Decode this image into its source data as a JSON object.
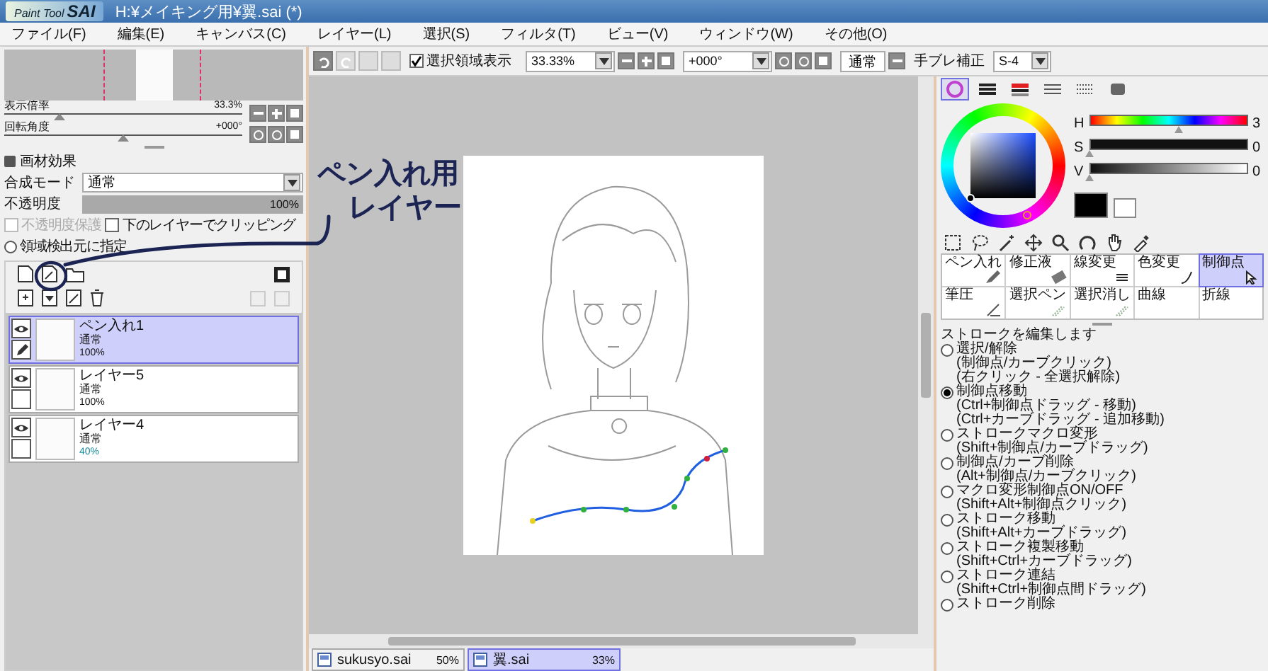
{
  "window": {
    "logo_top": "Paint Tool",
    "logo_main": "SAI",
    "title": "H:¥メイキング用¥翼.sai (*)"
  },
  "menu": [
    "ファイル(F)",
    "編集(E)",
    "キャンバス(C)",
    "レイヤー(L)",
    "選択(S)",
    "フィルタ(T)",
    "ビュー(V)",
    "ウィンドウ(W)",
    "その他(O)"
  ],
  "navigator": {
    "zoom": {
      "label": "表示倍率",
      "value": "33.3%",
      "level": 0.23
    },
    "rotation": {
      "label": "回転角度",
      "value": "+000°",
      "level": 0.5
    }
  },
  "layer_settings": {
    "texture_effect": "画材効果",
    "blend": {
      "label": "合成モード",
      "value": "通常"
    },
    "opacity": {
      "label": "不透明度",
      "value": "100%",
      "level": 1
    },
    "options": [
      {
        "label": "不透明度保護",
        "checked": false,
        "disabled": true
      },
      {
        "label": "下のレイヤーでクリッピング",
        "checked": false,
        "disabled": false
      }
    ],
    "source_radio": {
      "label": "領域検出元に指定",
      "selected": false
    }
  },
  "layers": [
    {
      "name": "ペン入れ1",
      "mode": "通常",
      "opacity": "100%",
      "selected": true,
      "visible": true,
      "pen": true,
      "dimmed": false
    },
    {
      "name": "レイヤー5",
      "mode": "通常",
      "opacity": "100%",
      "selected": false,
      "visible": true,
      "pen": false,
      "dimmed": false
    },
    {
      "name": "レイヤー4",
      "mode": "通常",
      "opacity": "40%",
      "selected": false,
      "visible": true,
      "pen": false,
      "dimmed": true
    }
  ],
  "toolbar": {
    "show_selection": {
      "label": "選択領域表示",
      "checked": true
    },
    "zoom": "33.33%",
    "angle": "+000°",
    "mode": "通常",
    "stabilizer_label": "手ブレ補正",
    "stabilizer": "S-4"
  },
  "color_tabs": [
    {
      "kind": "wheel",
      "selected": true
    },
    {
      "kind": "rgb",
      "selected": false
    },
    {
      "kind": "hsv",
      "selected": false
    },
    {
      "kind": "list",
      "selected": false
    },
    {
      "kind": "swatches",
      "selected": false
    },
    {
      "kind": "scratch",
      "selected": false
    }
  ],
  "hsv": [
    {
      "label": "H",
      "value": "3",
      "level": 0.56,
      "kind": "hue"
    },
    {
      "label": "S",
      "value": "0",
      "level": 0,
      "kind": "sat"
    },
    {
      "label": "V",
      "value": "0",
      "level": 0,
      "kind": "val"
    }
  ],
  "brushes": [
    {
      "name": "ペン入れ",
      "selected": false,
      "kind": "pen"
    },
    {
      "name": "修正液",
      "selected": false,
      "kind": "eraser"
    },
    {
      "name": "線変更",
      "selected": false,
      "kind": "lines"
    },
    {
      "name": "色変更",
      "selected": false,
      "kind": "color"
    },
    {
      "name": "制御点",
      "selected": true,
      "kind": "cursor"
    },
    {
      "name": "筆圧",
      "selected": false,
      "kind": "pressure"
    },
    {
      "name": "選択ペン",
      "selected": false,
      "kind": "select"
    },
    {
      "name": "選択消し",
      "selected": false,
      "kind": "select"
    },
    {
      "name": "曲線",
      "selected": false,
      "kind": "none"
    },
    {
      "name": "折線",
      "selected": false,
      "kind": "none"
    }
  ],
  "stroke_edit": {
    "heading": "ストロークを編集します",
    "modes": [
      {
        "label": "選択/解除",
        "selected": false,
        "hints": [
          "(制御点/カーブクリック)",
          "(右クリック - 全選択解除)"
        ]
      },
      {
        "label": "制御点移動",
        "selected": true,
        "hints": [
          "(Ctrl+制御点ドラッグ - 移動)",
          "(Ctrl+カーブドラッグ - 追加移動)"
        ]
      },
      {
        "label": "ストロークマクロ変形",
        "selected": false,
        "hints": [
          "(Shift+制御点/カーブドラッグ)"
        ]
      },
      {
        "label": "制御点/カーブ削除",
        "selected": false,
        "hints": [
          "(Alt+制御点/カーブクリック)"
        ]
      },
      {
        "label": "マクロ変形制御点ON/OFF",
        "selected": false,
        "hints": [
          "(Shift+Alt+制御点クリック)"
        ]
      },
      {
        "label": "ストローク移動",
        "selected": false,
        "hints": [
          "(Shift+Alt+カーブドラッグ)"
        ]
      },
      {
        "label": "ストローク複製移動",
        "selected": false,
        "hints": [
          "(Shift+Ctrl+カーブドラッグ)"
        ]
      },
      {
        "label": "ストローク連結",
        "selected": false,
        "hints": [
          "(Shift+Ctrl+制御点間ドラッグ)"
        ]
      },
      {
        "label": "ストローク削除",
        "selected": false
      }
    ]
  },
  "document_tabs": [
    {
      "name": "sukusyo.sai",
      "zoom": "50%",
      "selected": false
    },
    {
      "name": "翼.sai",
      "zoom": "33%",
      "selected": true
    }
  ],
  "annotation": {
    "lines": [
      "ペン入れ用",
      "レイヤー"
    ]
  }
}
